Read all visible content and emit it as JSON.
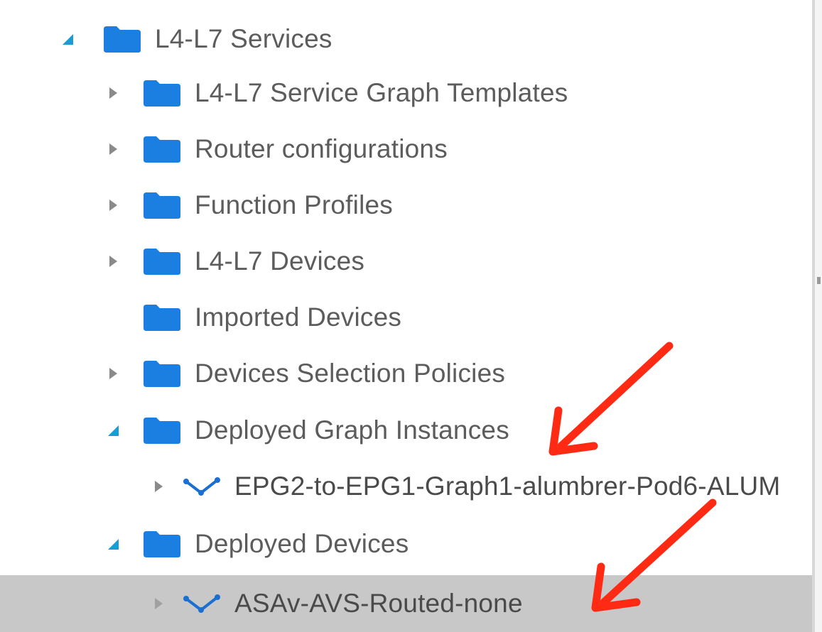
{
  "tree": {
    "items": [
      {
        "label": "L4-L7 Services",
        "state": "expanded",
        "icon": "folder-icon",
        "level": 0
      },
      {
        "label": "L4-L7 Service Graph Templates",
        "state": "collapsed",
        "icon": "folder-icon",
        "level": 1
      },
      {
        "label": "Router configurations",
        "state": "collapsed",
        "icon": "folder-icon",
        "level": 1
      },
      {
        "label": "Function Profiles",
        "state": "collapsed",
        "icon": "folder-icon",
        "level": 1
      },
      {
        "label": "L4-L7 Devices",
        "state": "collapsed",
        "icon": "folder-icon",
        "level": 1
      },
      {
        "label": "Imported Devices",
        "state": "leaf",
        "icon": "folder-icon",
        "level": 1
      },
      {
        "label": "Devices Selection Policies",
        "state": "collapsed",
        "icon": "folder-icon",
        "level": 1
      },
      {
        "label": "Deployed Graph Instances",
        "state": "expanded",
        "icon": "folder-icon",
        "level": 1
      },
      {
        "label": "EPG2-to-EPG1-Graph1-alumbrer-Pod6-ALUM",
        "state": "collapsed",
        "icon": "graph-icon",
        "level": 2
      },
      {
        "label": "Deployed Devices",
        "state": "expanded",
        "icon": "folder-icon",
        "level": 1
      },
      {
        "label": "ASAv-AVS-Routed-none",
        "state": "collapsed",
        "icon": "graph-icon",
        "level": 2,
        "selected": true
      }
    ]
  },
  "colors": {
    "folder": "#1a7fe0",
    "expand_arrow": "#1c9ad6",
    "collapse_arrow": "#8a8a8a",
    "graph_icon": "#1a6fd0",
    "selected_row": "#c8c8c8",
    "annotation_arrow": "#ff2a14",
    "label_text": "#5c5c5c"
  },
  "annotations": [
    {
      "name": "arrow-to-deployed-graph-instances",
      "icon": "red-arrow"
    },
    {
      "name": "arrow-to-asav-avs-routed-none",
      "icon": "red-arrow"
    }
  ]
}
